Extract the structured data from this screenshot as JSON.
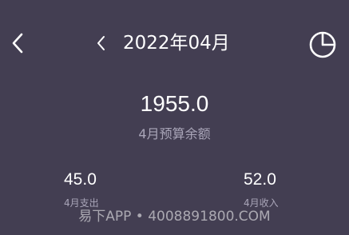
{
  "header": {
    "back_icon": "chevron-left-icon",
    "prev_month_icon": "chevron-left-icon",
    "month_label": "2022年04月",
    "chart_icon": "pie-chart-icon"
  },
  "budget": {
    "value": "1955.0",
    "caption": "4月预算余额"
  },
  "stats": {
    "expense_value": "45.0",
    "expense_caption": "4月支出",
    "income_value": "52.0",
    "income_caption": "4月收入"
  },
  "watermark": "易下APP • 4008891800.COM",
  "colors": {
    "background": "#433e52",
    "text_primary": "#ffffff",
    "text_secondary": "#a9a5b8"
  }
}
